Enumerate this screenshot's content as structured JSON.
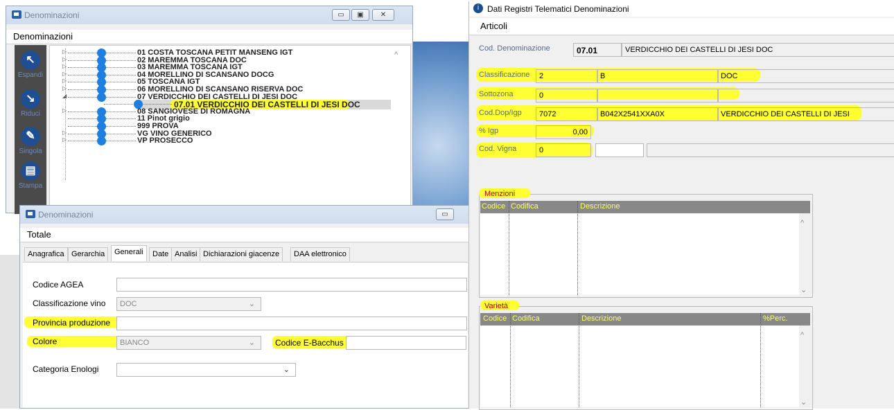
{
  "left_window": {
    "title": "Denominazioni",
    "menu_label": "Denominazioni",
    "sidebar": [
      {
        "label": "Espandi",
        "icon": "expand-icon"
      },
      {
        "label": "Riduci",
        "icon": "collapse-icon"
      },
      {
        "label": "Singola",
        "icon": "edit-icon"
      },
      {
        "label": "Stampa",
        "icon": "print-icon"
      }
    ],
    "tree": [
      "01 COSTA TOSCANA PETIT MANSENG IGT",
      "02 MAREMMA TOSCANA DOC",
      "03 MAREMMA TOSCANA IGT",
      "04 MORELLINO DI SCANSANO DOCG",
      "05 TOSCANA IGT",
      "06 MORELLINO DI SCANSANO RISERVA DOC",
      "07 VERDICCHIO DEI CASTELLI DI JESI DOC",
      "07.01 VERDICCHIO DEI CASTELLI DI JESI DOC",
      "08 SANGIOVESE DI ROMAGNA",
      "11 Pinot grigio",
      "999 PROVA",
      "VG VINO GENERICO",
      "VP PROSECCO"
    ]
  },
  "bottom_window": {
    "title": "Denominazioni",
    "menu_label": "Totale",
    "tabs": [
      "Anagrafica",
      "Gerarchia",
      "Generali",
      "Date",
      "Analisi",
      "Dichiarazioni giacenze",
      "DAA elettronico"
    ],
    "selected_tab": "Generali",
    "fields": {
      "codice_agea_label": "Codice AGEA",
      "codice_agea_value": "",
      "classificazione_label": "Classificazione vino",
      "classificazione_value": "DOC",
      "provincia_label": "Provincia produzione",
      "provincia_value": "",
      "colore_label": "Colore",
      "colore_value": "BIANCO",
      "bacchus_label": "Codice E-Bacchus",
      "bacchus_value": "",
      "categoria_label": "Categoria Enologi",
      "categoria_value": ""
    }
  },
  "right_window": {
    "title": "Dati Registri Telematici Denominazioni",
    "menu_label": "Articoli",
    "cod_denominazione_label": "Cod. Denominazione",
    "cod_denominazione_code": "07.01",
    "cod_denominazione_desc": "VERDICCHIO DEI CASTELLI DI JESI DOC",
    "classificazione_label": "Classificazione",
    "classificazione_values": [
      "2",
      "B",
      "DOC"
    ],
    "sottozona_label": "Sottozona",
    "sottozona_value": "0",
    "cod_dop_label": "Cod.Dop/Igp",
    "cod_dop_values": [
      "7072",
      "B042X2541XXA0X",
      "VERDICCHIO DEI CASTELLI DI JESI"
    ],
    "igp_label": "% Igp",
    "igp_value": "0,00",
    "vigna_label": "Cod. Vigna",
    "vigna_value": "0",
    "menzioni": {
      "label": "Menzioni",
      "columns": [
        "Codice",
        "Codifica",
        "Descrizione"
      ]
    },
    "varieta": {
      "label": "Varietà",
      "columns": [
        "Codice",
        "Codifica",
        "Descrizione",
        "%Perc."
      ]
    }
  }
}
